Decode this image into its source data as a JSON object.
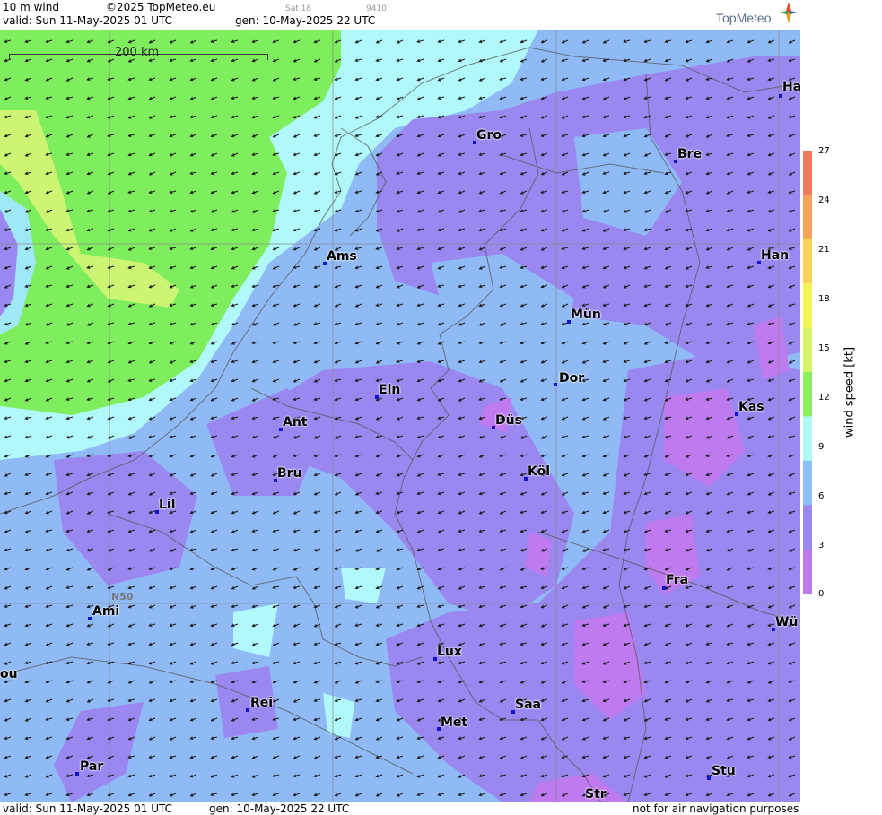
{
  "header": {
    "title": "10 m wind",
    "copyright": "©2025 TopMeteo.eu",
    "valid": "valid:  Sun  11-May-2025  01 UTC",
    "gen": "gen: 10-May-2025 22 UTC",
    "sat": "Sat 18",
    "code": "9410",
    "logo": "TopMeteo"
  },
  "map": {
    "scale_label": "200 km",
    "lat_label": "N50",
    "cities": [
      {
        "name": "Ha"
      },
      {
        "name": "Gro"
      },
      {
        "name": "Bre"
      },
      {
        "name": "Ams"
      },
      {
        "name": "Han"
      },
      {
        "name": "Mün"
      },
      {
        "name": "Ein"
      },
      {
        "name": "Dor"
      },
      {
        "name": "Ant"
      },
      {
        "name": "Düs"
      },
      {
        "name": "Kas"
      },
      {
        "name": "Bru"
      },
      {
        "name": "Köl"
      },
      {
        "name": "Lil"
      },
      {
        "name": "Fra"
      },
      {
        "name": "Ami"
      },
      {
        "name": "Wü"
      },
      {
        "name": "Lux"
      },
      {
        "name": "ou"
      },
      {
        "name": "Rei"
      },
      {
        "name": "Saa"
      },
      {
        "name": "Met"
      },
      {
        "name": "Par"
      },
      {
        "name": "Stu"
      },
      {
        "name": "Str"
      }
    ]
  },
  "legend": {
    "title": "wind  speed  [kt]",
    "ticks": [
      "27",
      "24",
      "21",
      "18",
      "15",
      "12",
      "9",
      "6",
      "3",
      "0"
    ],
    "colors": [
      "#f07a5a",
      "#f5a35a",
      "#f8d25a",
      "#f5f55a",
      "#d6f56a",
      "#8ef060",
      "#aef8f8",
      "#8ec0f8",
      "#9a88f0",
      "#c07af0"
    ]
  },
  "footer": {
    "valid": "valid:  Sun  11-May-2025  01 UTC",
    "gen": "gen: 10-May-2025 22 UTC",
    "disclaimer": "not for air navigation purposes"
  }
}
